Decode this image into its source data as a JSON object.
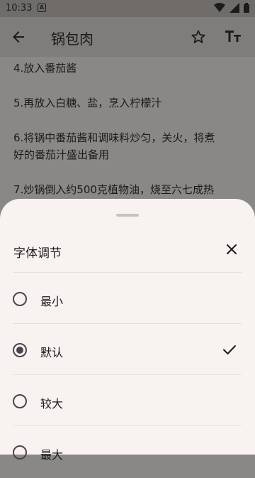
{
  "status_bar": {
    "time": "10:33",
    "notification_icon_letter": "A"
  },
  "app_bar": {
    "title": "锅包肉"
  },
  "content": {
    "steps": [
      "4.放入番茄酱",
      "5.再放入白糖、盐，烹入柠檬汁",
      "6.将锅中番茄酱和调味料炒匀，关火，将煮",
      "好的番茄汁盛出备用",
      "7.炒锅倒入约500克植物油，烧至六七成热"
    ]
  },
  "sheet": {
    "title": "字体调节",
    "options": [
      {
        "label": "最小",
        "selected": false
      },
      {
        "label": "默认",
        "selected": true
      },
      {
        "label": "较大",
        "selected": false
      },
      {
        "label": "最大",
        "selected": false
      }
    ]
  },
  "colors": {
    "sheet_bg": "#f8f2f0",
    "scrim": "#8a8886",
    "text": "#1b1b1b"
  }
}
